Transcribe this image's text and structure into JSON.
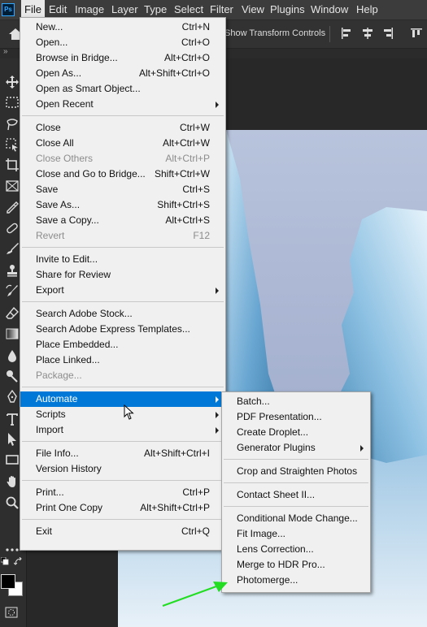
{
  "menubar": {
    "logo": "Ps",
    "items": [
      "File",
      "Edit",
      "Image",
      "Layer",
      "Type",
      "Select",
      "Filter",
      "View",
      "Plugins",
      "Window",
      "Help"
    ]
  },
  "options_bar": {
    "show_transform_controls": "Show Transform Controls"
  },
  "file_menu": {
    "groups": [
      [
        {
          "label": "New...",
          "shortcut": "Ctrl+N"
        },
        {
          "label": "Open...",
          "shortcut": "Ctrl+O"
        },
        {
          "label": "Browse in Bridge...",
          "shortcut": "Alt+Ctrl+O"
        },
        {
          "label": "Open As...",
          "shortcut": "Alt+Shift+Ctrl+O"
        },
        {
          "label": "Open as Smart Object...",
          "shortcut": ""
        },
        {
          "label": "Open Recent",
          "shortcut": "",
          "submenu": true
        }
      ],
      [
        {
          "label": "Close",
          "shortcut": "Ctrl+W"
        },
        {
          "label": "Close All",
          "shortcut": "Alt+Ctrl+W"
        },
        {
          "label": "Close Others",
          "shortcut": "Alt+Ctrl+P",
          "disabled": true
        },
        {
          "label": "Close and Go to Bridge...",
          "shortcut": "Shift+Ctrl+W"
        },
        {
          "label": "Save",
          "shortcut": "Ctrl+S"
        },
        {
          "label": "Save As...",
          "shortcut": "Shift+Ctrl+S"
        },
        {
          "label": "Save a Copy...",
          "shortcut": "Alt+Ctrl+S"
        },
        {
          "label": "Revert",
          "shortcut": "F12",
          "disabled": true
        }
      ],
      [
        {
          "label": "Invite to Edit...",
          "shortcut": ""
        },
        {
          "label": "Share for Review",
          "shortcut": ""
        },
        {
          "label": "Export",
          "shortcut": "",
          "submenu": true
        }
      ],
      [
        {
          "label": "Search Adobe Stock...",
          "shortcut": ""
        },
        {
          "label": "Search Adobe Express Templates...",
          "shortcut": ""
        },
        {
          "label": "Place Embedded...",
          "shortcut": ""
        },
        {
          "label": "Place Linked...",
          "shortcut": ""
        },
        {
          "label": "Package...",
          "shortcut": "",
          "disabled": true
        }
      ],
      [
        {
          "label": "Automate",
          "shortcut": "",
          "submenu": true,
          "highlight": true
        },
        {
          "label": "Scripts",
          "shortcut": "",
          "submenu": true
        },
        {
          "label": "Import",
          "shortcut": "",
          "submenu": true
        }
      ],
      [
        {
          "label": "File Info...",
          "shortcut": "Alt+Shift+Ctrl+I"
        },
        {
          "label": "Version History",
          "shortcut": ""
        }
      ],
      [
        {
          "label": "Print...",
          "shortcut": "Ctrl+P"
        },
        {
          "label": "Print One Copy",
          "shortcut": "Alt+Shift+Ctrl+P"
        }
      ],
      [
        {
          "label": "Exit",
          "shortcut": "Ctrl+Q"
        }
      ]
    ]
  },
  "automate_menu": {
    "groups": [
      [
        {
          "label": "Batch..."
        },
        {
          "label": "PDF Presentation..."
        },
        {
          "label": "Create Droplet..."
        },
        {
          "label": "Generator Plugins",
          "submenu": true
        }
      ],
      [
        {
          "label": "Crop and Straighten Photos"
        }
      ],
      [
        {
          "label": "Contact Sheet II..."
        }
      ],
      [
        {
          "label": "Conditional Mode Change..."
        },
        {
          "label": "Fit Image..."
        },
        {
          "label": "Lens Correction..."
        },
        {
          "label": "Merge to HDR Pro..."
        },
        {
          "label": "Photomerge..."
        }
      ]
    ]
  },
  "colors": {
    "highlight": "#0078d7",
    "annotation_arrow": "#22dd22"
  },
  "toolbar_icons": [
    "move-icon",
    "marquee-icon",
    "lasso-icon",
    "object-select-icon",
    "crop-icon",
    "frame-icon",
    "eyedropper-icon",
    "healing-icon",
    "brush-icon",
    "stamp-icon",
    "history-brush-icon",
    "eraser-icon",
    "gradient-icon",
    "blur-icon",
    "dodge-icon",
    "pen-icon",
    "type-icon",
    "path-select-icon",
    "rectangle-icon",
    "hand-icon",
    "zoom-icon",
    "more-tools-icon"
  ]
}
